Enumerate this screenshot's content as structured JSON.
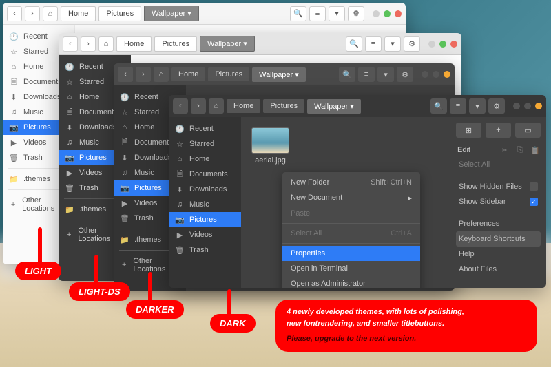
{
  "breadcrumbs": {
    "home": "Home",
    "pictures": "Pictures",
    "wallpaper": "Wallpaper"
  },
  "sidebar": {
    "items": [
      {
        "label": "Recent",
        "icon": "clock"
      },
      {
        "label": "Starred",
        "icon": "star"
      },
      {
        "label": "Home",
        "icon": "home"
      },
      {
        "label": "Documents",
        "icon": "doc"
      },
      {
        "label": "Downloads",
        "icon": "down"
      },
      {
        "label": "Music",
        "icon": "music"
      },
      {
        "label": "Pictures",
        "icon": "cam",
        "sel": true
      },
      {
        "label": "Videos",
        "icon": "video"
      },
      {
        "label": "Trash",
        "icon": "trash"
      }
    ],
    "themes_label": ".themes",
    "other_label": "Other Locations"
  },
  "file": {
    "name": "aerial.jpg"
  },
  "context_menu": [
    {
      "label": "New Folder",
      "accel": "Shift+Ctrl+N"
    },
    {
      "label": "New Document",
      "submenu": true
    },
    {
      "label": "Paste",
      "disabled": true
    },
    {
      "label": "Select All",
      "accel": "Ctrl+A",
      "disabled": true
    },
    {
      "label": "Properties",
      "selected": true
    },
    {
      "label": "Open in Terminal"
    },
    {
      "label": "Open as Administrator"
    }
  ],
  "panel": {
    "edit_label": "Edit",
    "select_all": "Select All",
    "show_hidden": "Show Hidden Files",
    "show_sidebar": "Show Sidebar",
    "preferences": "Preferences",
    "keyboard": "Keyboard Shortcuts",
    "help": "Help",
    "about": "About Files"
  },
  "labels": {
    "light": "LIGHT",
    "lightds": "LIGHT-DS",
    "darker": "DARKER",
    "dark": "DARK"
  },
  "promo": {
    "line1": "4 newly developed themes, with lots of polishing,",
    "line2": "new fontrendering, and smaller titlebuttons.",
    "line3": "Please, upgrade to the next version."
  }
}
